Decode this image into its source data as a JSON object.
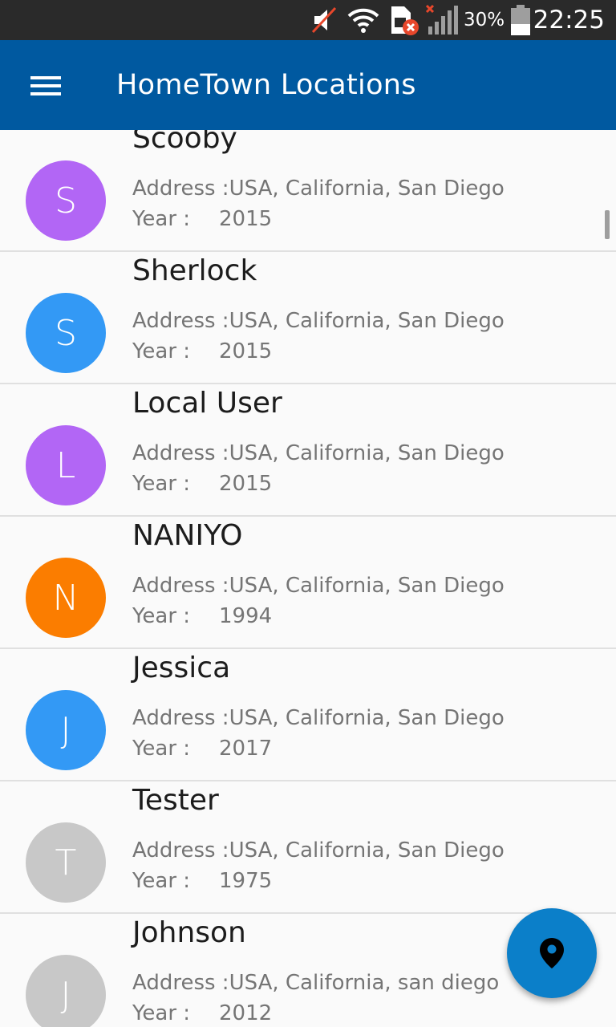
{
  "status_bar": {
    "battery_percent": "30%",
    "time": "22:25",
    "icons": [
      "muted-speaker-icon",
      "wifi-icon",
      "sim-error-icon",
      "signal-icon",
      "battery-icon"
    ]
  },
  "app_bar": {
    "title": "HomeTown Locations",
    "menu_icon": "hamburger-menu-icon"
  },
  "colors": {
    "app_bar": "#0059a0",
    "fab": "#0b7fc9",
    "purple": "#b266f5",
    "blue": "#3399f5",
    "orange": "#fb7d00",
    "grey": "#c8c8c8"
  },
  "list": {
    "address_label": "Address :",
    "year_label": "Year :",
    "items": [
      {
        "initial": "S",
        "name": "Scooby",
        "address": "USA, California, San Diego",
        "year": "2015",
        "color": "#b266f5"
      },
      {
        "initial": "S",
        "name": "Sherlock",
        "address": "USA, California, San Diego",
        "year": "2015",
        "color": "#3399f5"
      },
      {
        "initial": "L",
        "name": "Local User",
        "address": "USA, California, San Diego",
        "year": "2015",
        "color": "#b266f5"
      },
      {
        "initial": "N",
        "name": "NANIYO",
        "address": "USA, California, San Diego",
        "year": "1994",
        "color": "#fb7d00"
      },
      {
        "initial": "J",
        "name": "Jessica",
        "address": "USA, California, San Diego",
        "year": "2017",
        "color": "#3399f5"
      },
      {
        "initial": "T",
        "name": "Tester",
        "address": "USA, California, San Diego",
        "year": "1975",
        "color": "#c8c8c8"
      },
      {
        "initial": "J",
        "name": "Johnson",
        "address": "USA, California, san diego",
        "year": "2012",
        "color": "#c8c8c8"
      }
    ]
  },
  "fab": {
    "icon": "map-pin-icon"
  }
}
